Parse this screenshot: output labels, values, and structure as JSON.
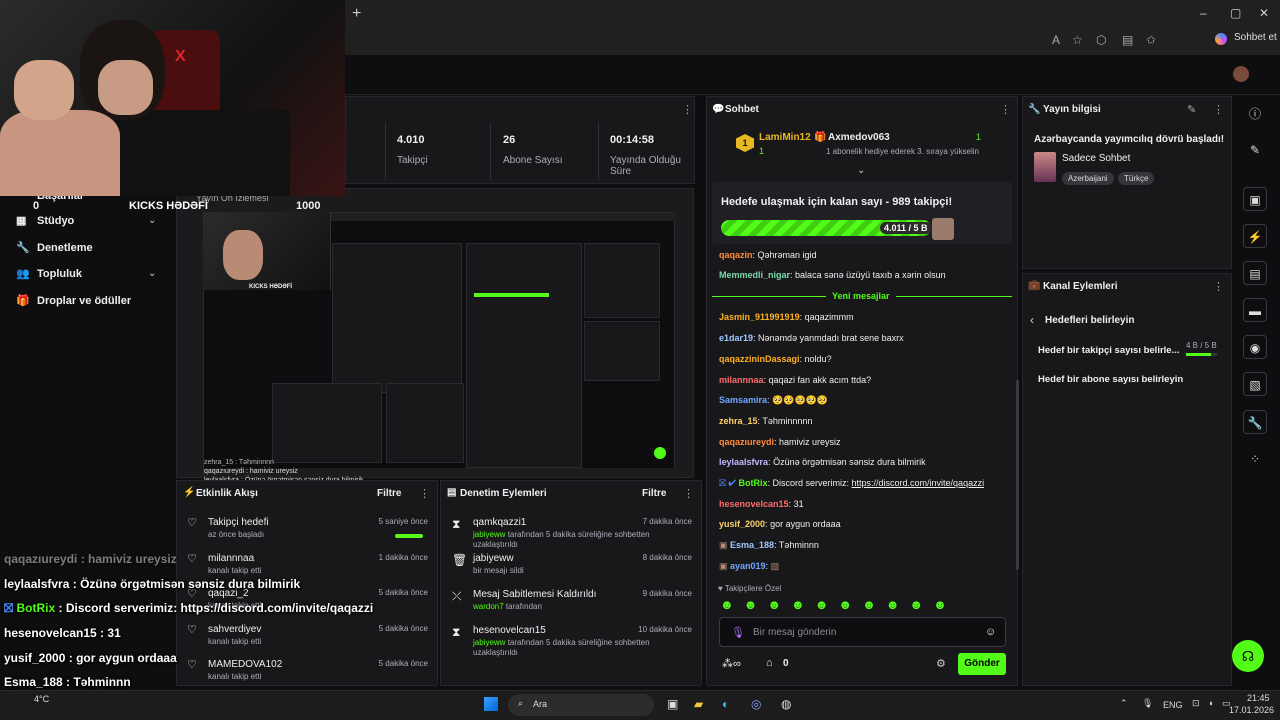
{
  "browser": {
    "new_tab": "+",
    "chat_btn": "Sohbet et",
    "window_controls": [
      "–",
      "▢",
      "✕"
    ]
  },
  "webcam": {
    "goal_left": "0",
    "goal_label": "KICKS HƏDƏFİ",
    "goal_right": "1000"
  },
  "nav": {
    "items": [
      {
        "label": "Başarılar",
        "icon": "trophy-icon"
      },
      {
        "label": "Stüdyo",
        "icon": "grid-icon",
        "chevron": true
      },
      {
        "label": "Denetleme",
        "icon": "wrench-icon"
      },
      {
        "label": "Topluluk",
        "icon": "people-icon",
        "chevron": true
      },
      {
        "label": "Droplar ve ödüller",
        "icon": "gift-icon"
      }
    ]
  },
  "stats": [
    {
      "value": "4.010",
      "label": "Takipçi"
    },
    {
      "value": "26",
      "label": "Abone Sayısı"
    },
    {
      "value": "00:14:58",
      "label": "Yayında Olduğu Süre"
    }
  ],
  "preview": {
    "header": "Yayın Ön İzlemesi"
  },
  "activity": {
    "title": "Etkinlik Akışı",
    "filter": "Filtre",
    "items": [
      {
        "title": "Takipçi hedefi",
        "sub": "az önce başladı",
        "time": "5 saniye önce",
        "icon": "heart-icon"
      },
      {
        "title": "milannnaa",
        "sub": "kanalı takip etti",
        "time": "1 dakika önce",
        "icon": "heart-icon"
      },
      {
        "title": "qaqazi_2",
        "sub": "kanalı takip etti",
        "time": "5 dakika önce",
        "icon": "heart-icon"
      },
      {
        "title": "sahverdiyev",
        "sub": "kanalı takip etti",
        "time": "5 dakika önce",
        "icon": "heart-icon"
      },
      {
        "title": "MAMEDOVA102",
        "sub": "kanalı takip etti",
        "time": "5 dakika önce",
        "icon": "heart-icon"
      }
    ]
  },
  "moderation": {
    "title": "Denetim Eylemleri",
    "filter": "Filtre",
    "items": [
      {
        "title": "qamkqazzi1",
        "by": "jabiyeww",
        "rest": "tarafından 5 dakika süreliğine sohbetten uzaklaştırıldı",
        "time": "7 dakika önce",
        "icon": "hourglass-icon"
      },
      {
        "title": "jabiyeww",
        "by": "",
        "rest": "bir mesajı sildi",
        "time": "8 dakika önce",
        "icon": "trash-icon"
      },
      {
        "title": "Mesaj Sabitlemesi Kaldırıldı",
        "by": "wardon7",
        "rest": "tarafından",
        "time": "9 dakika önce",
        "icon": "unpin-icon"
      },
      {
        "title": "hesenovelcan15",
        "by": "jabiyeww",
        "rest": "tarafından 5 dakika süreliğine sohbetten uzaklaştırıldı",
        "time": "10 dakika önce",
        "icon": "hourglass-icon"
      }
    ]
  },
  "overlay_chat": [
    {
      "user": "qaqazıureydi",
      "msg": "hamiviz ureysiz",
      "faded": true
    },
    {
      "user": "leylaalsfvra",
      "msg": "Özünə örgətmisən sənsiz dura bilmirik"
    },
    {
      "user": "BotRix",
      "msg": "Discord serverimiz: https://discord.com/invite/qaqazzi"
    },
    {
      "user": "hesenovelcan15",
      "msg": "31"
    },
    {
      "user": "yusif_2000",
      "msg": "gor aygun ordaaa"
    },
    {
      "user": "Esma_188",
      "msg": "Təhminnn"
    },
    {
      "user": "ayan019",
      "msg": ""
    }
  ],
  "chat": {
    "title": "Sohbet",
    "gifter1": "LamiMin12",
    "gifter1_count": "1",
    "gifter2": "Axmedov063",
    "gifter2_count": "1",
    "gift_msg": "1 abonelik hediye ederek 3. sıraya yükselin",
    "goal_text": "Hedefe ulaşmak için kalan sayı - 989 takipçi!",
    "goal_progress": "4.011 / 5 B",
    "new_messages": "Yeni mesajlar",
    "messages": [
      {
        "user": "qaqazin",
        "msg": "Qəhrəman igid",
        "color": "#ff8c3a"
      },
      {
        "user": "Memmedli_nigar",
        "msg": "balaca sənə üzüyü taxıb a xərin olsun",
        "color": "#7ad9a8"
      },
      {
        "user": "Jasmin_911991919",
        "msg": "qaqazimmm",
        "color": "#ffb020"
      },
      {
        "user": "e1dar19",
        "msg": "Nənəmdə yanmdadı brat sene baxrx",
        "color": "#9ec8ff"
      },
      {
        "user": "qaqazzininDassagi",
        "msg": "noldu?",
        "color": "#ffb020"
      },
      {
        "user": "milannnaa",
        "msg": "qaqazi fan akk acım ttda?",
        "color": "#ff6b6b"
      },
      {
        "user": "Samsamira",
        "msg": "🥺🥺🥺🥺🥺",
        "color": "#6fa8ff"
      },
      {
        "user": "zehra_15",
        "msg": "Təhminnnnn",
        "color": "#ffd166"
      },
      {
        "user": "qaqazıureydi",
        "msg": "hamiviz ureysiz",
        "color": "#ff8c3a"
      },
      {
        "user": "leylaalsfvra",
        "msg": "Özünə örgətmisən sənsiz dura bilmirik",
        "color": "#c7b6ff"
      },
      {
        "user": "BotRix",
        "msg": "Discord serverimiz:",
        "link": "https://discord.com/invite/qaqazzi",
        "color": "#53fc18"
      },
      {
        "user": "hesenovelcan15",
        "msg": "31",
        "color": "#ff6b6b"
      },
      {
        "user": "yusif_2000",
        "msg": "gor aygun ordaaa",
        "color": "#ffd166"
      },
      {
        "user": "Esma_188",
        "msg": "Təhminnn",
        "color": "#9ec8ff"
      },
      {
        "user": "ayan019",
        "msg": "",
        "color": "#6fa8ff"
      }
    ],
    "followers_only": "Takipçilere Özel",
    "input_placeholder": "Bir mesaj gönderin",
    "points": "0",
    "send": "Gönder"
  },
  "stream_info": {
    "title": "Yayın bilgisi",
    "stream_title": "Azərbaycanda yayımcılıq dövrü başladı!",
    "category": "Sadece Sohbet",
    "tags": [
      "Azerbaijani",
      "Türkçe"
    ]
  },
  "channel_actions": {
    "title": "Kanal Eylemleri",
    "back_label": "Hedefleri belirleyin",
    "follow_goal": "Hedef bir takipçi sayısı belirle...",
    "follow_goal_progress": "4 B / 5 B",
    "sub_goal": "Hedef bir abone sayısı belirleyin"
  },
  "taskbar": {
    "weather": "4°C",
    "search": "Ara",
    "lang": "ENG",
    "time": "21:45",
    "date": "17.01.2026"
  },
  "colors": {
    "accent": "#53fc18",
    "panel": "#18181b",
    "bg": "#0e0e10"
  }
}
